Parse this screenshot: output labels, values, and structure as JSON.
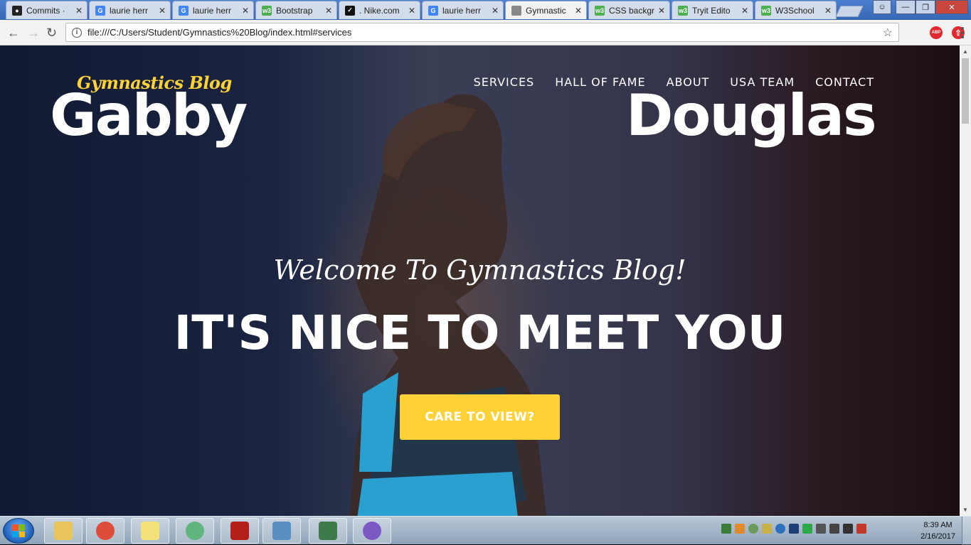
{
  "browser": {
    "tabs": [
      {
        "title": "Commits ·",
        "icon": "github-icon",
        "active": false
      },
      {
        "title": "laurie herr",
        "icon": "google-icon",
        "active": false
      },
      {
        "title": "laurie herr",
        "icon": "google-icon",
        "active": false
      },
      {
        "title": "Bootstrap",
        "icon": "w3schools-icon",
        "active": false
      },
      {
        "title": ". Nike.com",
        "icon": "nike-icon",
        "active": false
      },
      {
        "title": "laurie herr",
        "icon": "google-icon",
        "active": false
      },
      {
        "title": "Gymnastic",
        "icon": "page-icon",
        "active": true
      },
      {
        "title": "CSS backgr",
        "icon": "w3schools-icon",
        "active": false
      },
      {
        "title": "Tryit Edito",
        "icon": "w3schools-icon",
        "active": false
      },
      {
        "title": "W3School",
        "icon": "w3schools-icon",
        "active": false
      }
    ],
    "url": "file:///C:/Users/Student/Gymnastics%20Blog/index.html#services",
    "extensions": [
      {
        "name": "adblock-plus-icon",
        "label": "ABP",
        "color": "#e3272e"
      },
      {
        "name": "upload-extension-icon",
        "label": "",
        "color": "#e3272e"
      }
    ]
  },
  "site": {
    "brand_script": "Gymnastics Blog",
    "brand_left": "Gabby",
    "brand_right": "Douglas",
    "nav": [
      "SERVICES",
      "HALL OF FAME",
      "ABOUT",
      "USA TEAM",
      "CONTACT"
    ],
    "lead_in": "Welcome To Gymnastics Blog!",
    "heading": "IT'S NICE TO MEET YOU",
    "cta": "CARE TO VIEW?",
    "accent_color": "#fed136"
  },
  "taskbar": {
    "apps": [
      {
        "name": "file-explorer-icon",
        "color": "#e8c45a"
      },
      {
        "name": "chrome-icon",
        "color": "#dd4b39"
      },
      {
        "name": "sticky-notes-icon",
        "color": "#f3e27a"
      },
      {
        "name": "atom-icon",
        "color": "#5fb57d"
      },
      {
        "name": "acrobat-icon",
        "color": "#b3201a"
      },
      {
        "name": "photos-icon",
        "color": "#5a8fc2"
      },
      {
        "name": "network-app-icon",
        "color": "#3f7a4a"
      },
      {
        "name": "github-desktop-icon",
        "color": "#7b58c4"
      }
    ],
    "time": "8:39 AM",
    "date": "2/16/2017"
  }
}
